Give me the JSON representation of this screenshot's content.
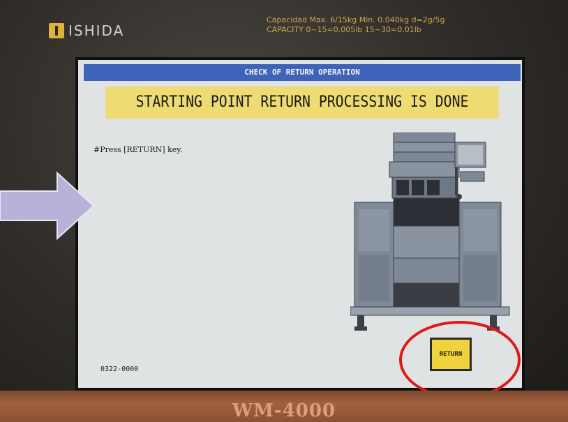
{
  "device": {
    "brand": "ISHIDA",
    "capacity_line1": "Capacidad  Max. 6/15kg  Min. 0.040kg  d=2g/5g",
    "capacity_line2": "CAPACITY  0~15=0.005lb  15~30=0.01lb",
    "model": "WM-4000"
  },
  "screen": {
    "title": "CHECK OF RETURN OPERATION",
    "status": "STARTING POINT RETURN PROCESSING IS DONE",
    "instruction": "#Press [RETURN] key.",
    "code": "0322-0000",
    "return_button_label": "RETURN"
  },
  "colors": {
    "title_bar": "#3f63b8",
    "status_banner": "#eedc72",
    "return_button": "#f0d23c",
    "highlight": "#e01818",
    "arrow": "#b9b2d8"
  },
  "icons": [
    "ishida-logo-icon",
    "machine-illustration-icon",
    "pointer-arrow-icon",
    "highlight-circle-icon"
  ]
}
